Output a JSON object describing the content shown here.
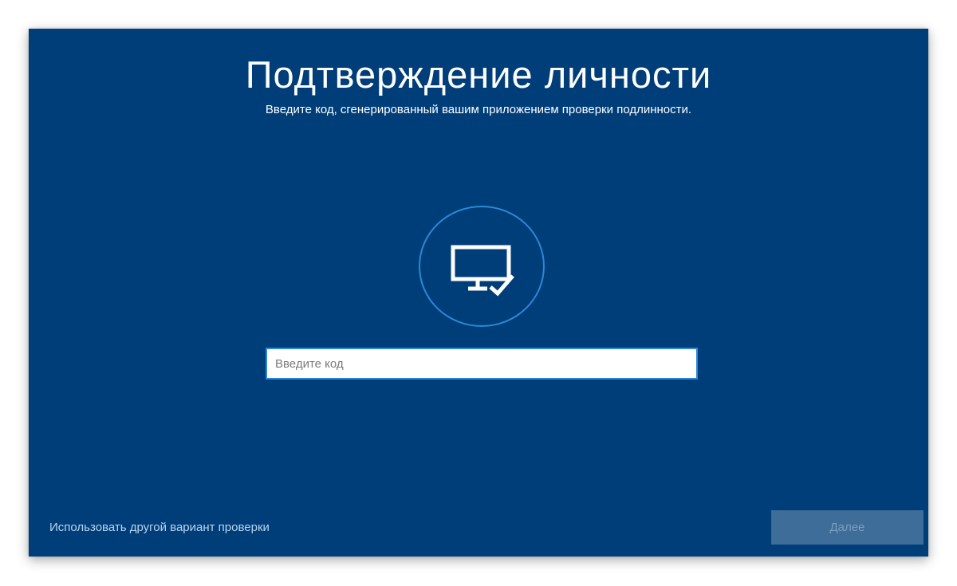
{
  "screen": {
    "title": "Подтверждение личности",
    "subtitle": "Введите код, сгенерированный вашим приложением проверки подлинности.",
    "icon": "monitor-check-icon",
    "code_input": {
      "value": "",
      "placeholder": "Введите код"
    },
    "alt_option_label": "Использовать другой вариант проверки",
    "next_label": "Далее",
    "next_enabled": false
  },
  "colors": {
    "background": "#003e79",
    "accent": "#2b88d8",
    "link": "#b8d4f0",
    "button_disabled_bg": "#3e6d99",
    "button_disabled_text": "#7d9dbb"
  }
}
